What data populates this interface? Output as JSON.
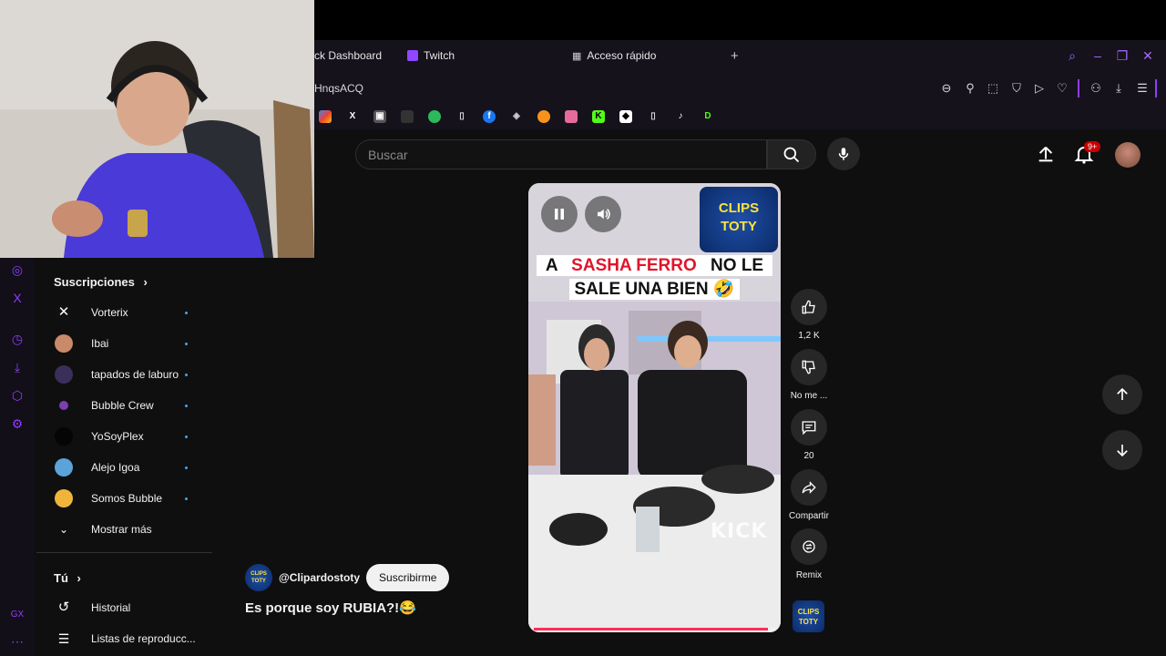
{
  "browser": {
    "tabs": [
      {
        "label": "ck Dashboard"
      },
      {
        "label": "Twitch"
      },
      {
        "label": "Acceso rápido"
      }
    ],
    "address_fragment": "HnqsACQ"
  },
  "youtube": {
    "search": {
      "placeholder": "Buscar"
    },
    "notification_count": "9+",
    "sidebar": {
      "subscriptions_title": "Suscripciones",
      "subscriptions": [
        {
          "name": "Vorterix",
          "color": "#111111"
        },
        {
          "name": "Ibai",
          "color": "#c98a6a"
        },
        {
          "name": "tapados de laburo",
          "color": "#3a2f5a"
        },
        {
          "name": "Bubble Crew",
          "color": "#7b3fb0"
        },
        {
          "name": "YoSoyPlex",
          "color": "#050505"
        },
        {
          "name": "Alejo Igoa",
          "color": "#5ba3d9"
        },
        {
          "name": "Somos Bubble",
          "color": "#f0b43a"
        }
      ],
      "show_more": "Mostrar más",
      "you_title": "Tú",
      "you_items": [
        {
          "label": "Historial"
        },
        {
          "label": "Listas de reproducc..."
        }
      ]
    },
    "short": {
      "caption_line1_pre": "A ",
      "caption_line1_red": "SASHA FERRO",
      "caption_line1_post": " NO LE",
      "caption_line2": "SALE UNA BIEN 🤣",
      "watermark": "KICK",
      "progress": 0.97,
      "channel_handle": "@Clipardostoty",
      "subscribe_label": "Suscribirme",
      "title": "Es porque soy RUBIA?!😂"
    },
    "actions": {
      "like_count": "1,2 K",
      "dislike_label": "No me ...",
      "comments_count": "20",
      "share_label": "Compartir",
      "remix_label": "Remix"
    },
    "colors": {
      "accent": "#8f3bff",
      "progress": "#ff2c55",
      "notif": "#cc0000"
    }
  }
}
